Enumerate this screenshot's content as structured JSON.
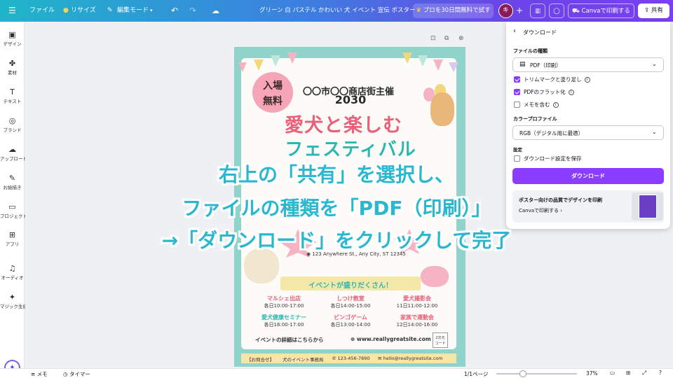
{
  "topbar": {
    "file": "ファイル",
    "resize": "リサイズ",
    "edit_mode": "編集モード",
    "doc_title": "グリーン 白 パステル かわいい 犬 イベント 宣伝 ポスター",
    "pro_trial": "プロを30日間無料で試す",
    "avatar_initial": "キ",
    "print_button": "Canvaで印刷する",
    "share_button": "共有"
  },
  "rail": [
    {
      "icon": "design-icon",
      "glyph": "▣",
      "label": "デザイン"
    },
    {
      "icon": "elements-icon",
      "glyph": "✤",
      "label": "素材"
    },
    {
      "icon": "text-icon",
      "glyph": "T",
      "label": "テキスト"
    },
    {
      "icon": "brand-icon",
      "glyph": "◎",
      "label": "ブランド"
    },
    {
      "icon": "upload-icon",
      "glyph": "☁",
      "label": "アップロード"
    },
    {
      "icon": "draw-icon",
      "glyph": "✎",
      "label": "お絵描き"
    },
    {
      "icon": "projects-icon",
      "glyph": "▭",
      "label": "プロジェクト"
    },
    {
      "icon": "apps-icon",
      "glyph": "⊞",
      "label": "アプリ"
    },
    {
      "icon": "audio-icon",
      "glyph": "♫",
      "label": "オーディオ"
    },
    {
      "icon": "magic-icon",
      "glyph": "✦",
      "label": "マジック生成"
    }
  ],
  "panel": {
    "title": "ダウンロード",
    "file_type_label": "ファイルの種類",
    "file_type_value": "PDF（印刷）",
    "options": [
      {
        "label": "トリムマークと塗り足し",
        "checked": true
      },
      {
        "label": "PDFのフラット化",
        "checked": true
      },
      {
        "label": "メモを含む",
        "checked": false
      }
    ],
    "color_profile_label": "カラープロファイル",
    "color_profile_value": "RGB（デジタル用に最適）",
    "settings_label": "設定",
    "save_settings": "ダウンロード設定を保存",
    "download_button": "ダウンロード",
    "promo_title": "ポスター向けの品質でデザインを印刷",
    "promo_link": "Canvaで印刷する"
  },
  "poster": {
    "free_badge_1": "入場",
    "free_badge_2": "無料",
    "organizer": "〇〇市〇〇商店街主催",
    "year": "2030",
    "headline": "愛犬と楽しむ",
    "subheadline": "フェスティバル",
    "address": "123 Anywhere St., Any City, ST 12345",
    "events_title": "イベントが盛りだくさん！",
    "events": [
      {
        "name": "マルシェ出店",
        "time": "各日10:00-17:00"
      },
      {
        "name": "しつけ教室",
        "time": "各日14:00-15:00"
      },
      {
        "name": "愛犬撮影会",
        "time": "11日11:00-12:00"
      },
      {
        "name": "愛犬健康セミナー",
        "time": "各日16:00-17:00"
      },
      {
        "name": "ビンゴゲーム",
        "time": "各日13:00-14:00"
      },
      {
        "name": "家族で運動会",
        "time": "12日14:00-16:00"
      }
    ],
    "details_text": "イベントの詳細はこちらから",
    "website": "www.reallygreatsite.com",
    "qr_label_1": "2次元",
    "qr_label_2": "コード",
    "contact_label": "【お問合せ】",
    "contact_org": "犬のイベント事務局",
    "phone": "123-456-7890",
    "email": "hello@reallygreatsite.com"
  },
  "bottombar": {
    "notes": "メモ",
    "timer": "タイマー",
    "page_count": "1/1ページ",
    "zoom": "37%"
  },
  "overlay": {
    "line1": "右上の「共有」を選択し、",
    "line2": "ファイルの種類を「PDF（印刷）」",
    "line3": "→「ダウンロード」をクリックして完了"
  },
  "colors": {
    "accent": "#8b3dff",
    "caption": "#2ab7cf",
    "poster_border": "#8fd3cb",
    "poster_pink": "#e8607a",
    "poster_teal": "#2cb8b0"
  }
}
